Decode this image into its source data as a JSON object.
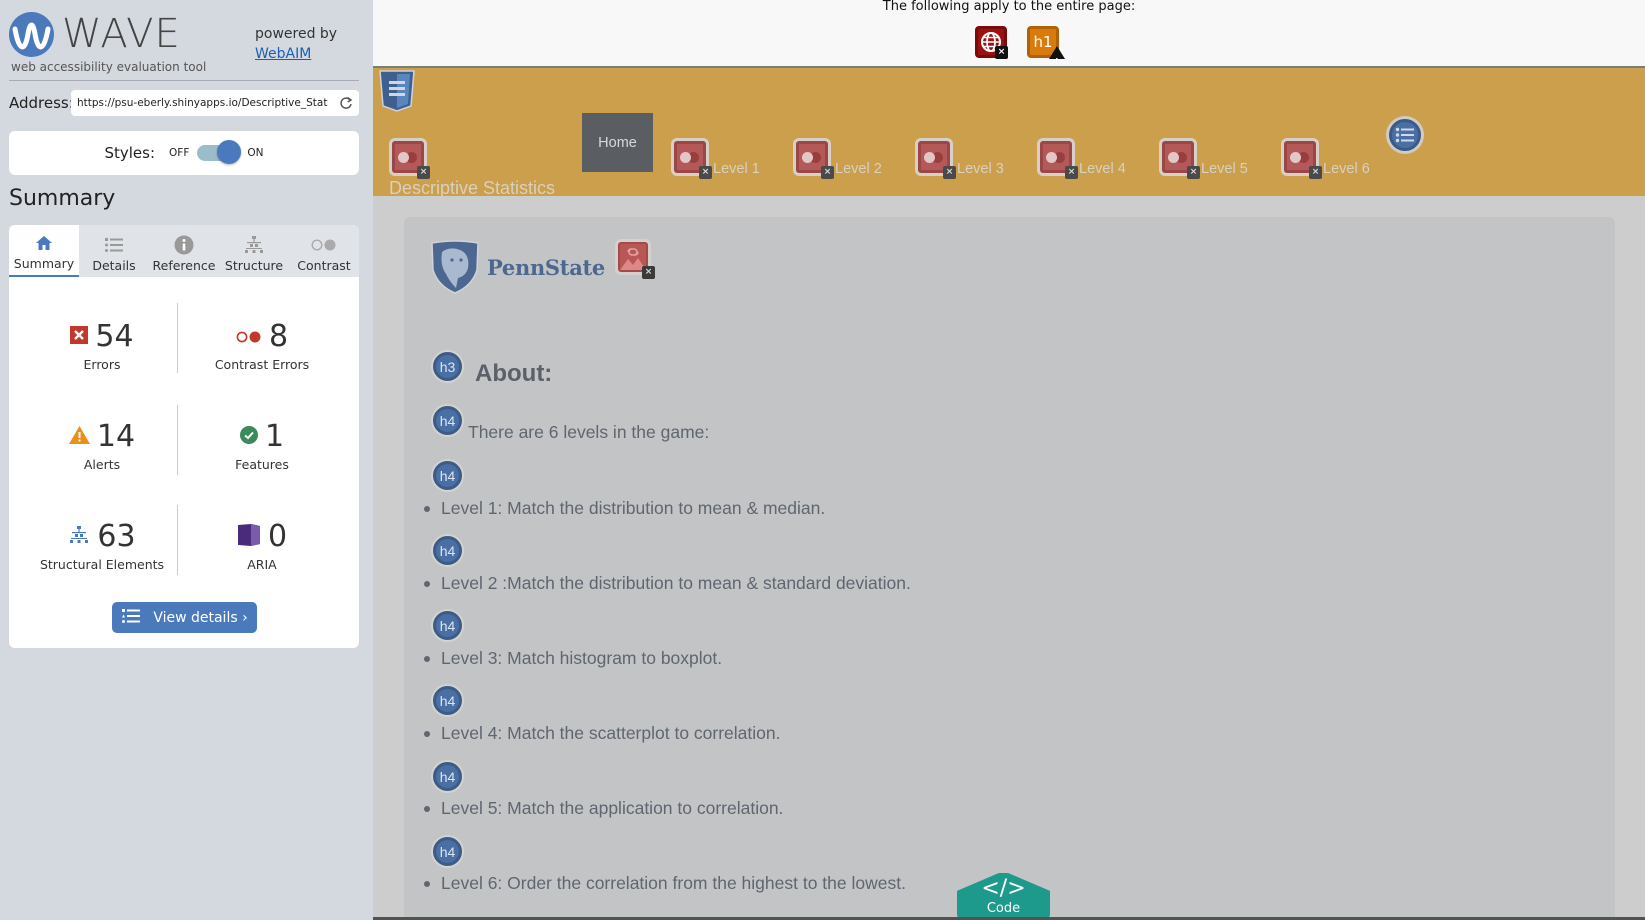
{
  "sidebar": {
    "brand": {
      "name": "WAVE",
      "tagline": "web accessibility evaluation tool",
      "powered_by": "powered by",
      "powered_link": "WebAIM"
    },
    "address": {
      "label": "Address:",
      "value": "https://psu-eberly.shinyapps.io/Descriptive_Stat",
      "reload_icon": "reload-icon"
    },
    "styles": {
      "label": "Styles:",
      "off": "OFF",
      "on": "ON",
      "state": "on"
    },
    "summary_heading": "Summary",
    "tabs": [
      {
        "label": "Summary",
        "icon": "home-icon",
        "active": true
      },
      {
        "label": "Details",
        "icon": "list-icon",
        "active": false
      },
      {
        "label": "Reference",
        "icon": "info-icon",
        "active": false
      },
      {
        "label": "Structure",
        "icon": "structure-icon",
        "active": false
      },
      {
        "label": "Contrast",
        "icon": "contrast-icon",
        "active": false
      }
    ],
    "stats": [
      {
        "key": "errors",
        "value": "54",
        "label": "Errors",
        "icon": "error-icon",
        "color": "#c0392b"
      },
      {
        "key": "contrast_errors",
        "value": "8",
        "label": "Contrast Errors",
        "icon": "contrast-error-icon",
        "color": "#c0392b"
      },
      {
        "key": "alerts",
        "value": "14",
        "label": "Alerts",
        "icon": "alert-icon",
        "color": "#e8901a"
      },
      {
        "key": "features",
        "value": "1",
        "label": "Features",
        "icon": "feature-icon",
        "color": "#3a8a5c"
      },
      {
        "key": "structural",
        "value": "63",
        "label": "Structural Elements",
        "icon": "structure-icon",
        "color": "#4a7abc"
      },
      {
        "key": "aria",
        "value": "0",
        "label": "ARIA",
        "icon": "aria-icon",
        "color": "#5a3a8a"
      }
    ],
    "view_details": "View details ›"
  },
  "page": {
    "header_text": "The following apply to the entire page:",
    "page_icons": [
      {
        "name": "language-missing-error",
        "icon": "globe-icon",
        "badge": "x"
      },
      {
        "name": "missing-h1-alert",
        "icon": "h1",
        "badge": "warning"
      }
    ],
    "nav": {
      "title": "Descriptive Statistics",
      "home": "Home",
      "levels": [
        "Level 1",
        "Level 2",
        "Level 3",
        "Level 4",
        "Level 5",
        "Level 6"
      ]
    },
    "brand": "PennState",
    "about_heading": "About:",
    "h3_badge": "h3",
    "h4_badge": "h4",
    "intro": "There are 6 levels in the game:",
    "levels_desc": [
      "Level 1: Match the distribution to mean & median.",
      "Level 2 :Match the distribution to mean & standard deviation.",
      "Level 3: Match histogram to boxplot.",
      "Level 4: Match the scatterplot to correlation.",
      "Level 5: Match the application to correlation.",
      "Level 6: Order the correlation from the highest to the lowest."
    ],
    "code_button": {
      "glyph": "</>",
      "label": "Code"
    }
  },
  "colors": {
    "wave_blue": "#4a7abc",
    "nav_gold": "#cb9f4b",
    "error_red": "#c0392b",
    "code_teal": "#1d9a8b"
  }
}
